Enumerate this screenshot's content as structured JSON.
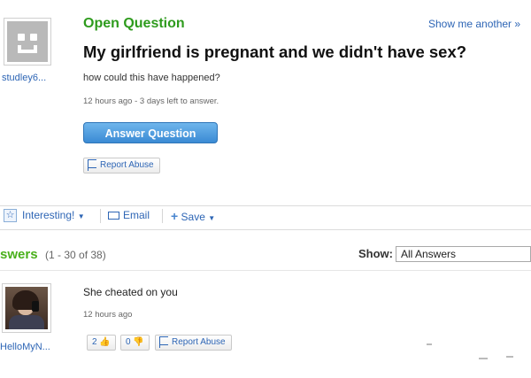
{
  "question": {
    "status": "Open Question",
    "show_another": "Show me another »",
    "title": "My girlfriend is pregnant and we didn't have sex?",
    "body": "how could this have happened?",
    "meta": "12 hours ago - 3 days left to answer.",
    "asker": "studley6...",
    "answer_button": "Answer Question",
    "report_abuse": "Report Abuse"
  },
  "actions": {
    "interesting": "Interesting!",
    "email": "Email",
    "save": "Save"
  },
  "answers": {
    "title": "swers",
    "count": "(1 - 30 of 38)",
    "show_label": "Show:",
    "show_value": "All Answers",
    "items": [
      {
        "user": "HelloMyN...",
        "text": "She cheated on you",
        "meta": "12 hours ago",
        "thumbs_up": "2",
        "thumbs_down": "0",
        "report_abuse": "Report Abuse"
      }
    ]
  },
  "colors": {
    "accent_green": "#2e9b1d",
    "link_blue": "#2d65b5",
    "button_blue": "#3a8ad4"
  }
}
